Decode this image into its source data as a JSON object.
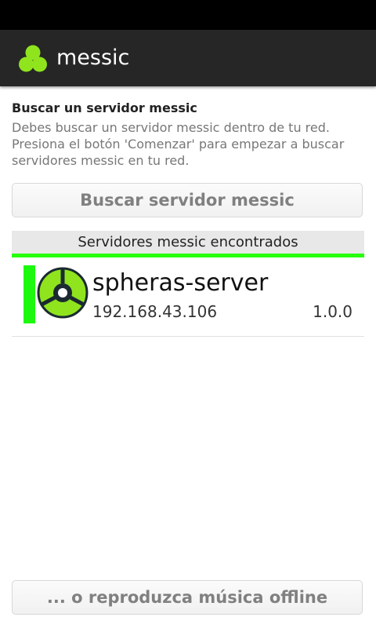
{
  "app": {
    "title": "messic",
    "logo_icon": "messic-logo-icon",
    "accent_color": "#27ff0c",
    "action_bar_color": "#262626"
  },
  "intro": {
    "title": "Buscar un servidor messic",
    "description": "Debes buscar un servidor messic dentro de tu red. Presiona el botón 'Comenzar' para empezar a buscar servidores messic en tu red."
  },
  "search_button": {
    "label": "Buscar servidor messic"
  },
  "servers": {
    "header": "Servidores messic encontrados",
    "items": [
      {
        "name": "spheras-server",
        "ip": "192.168.43.106",
        "version": "1.0.0",
        "icon": "messic-server-icon"
      }
    ]
  },
  "offline_button": {
    "label": "... o reproduzca música offline"
  }
}
